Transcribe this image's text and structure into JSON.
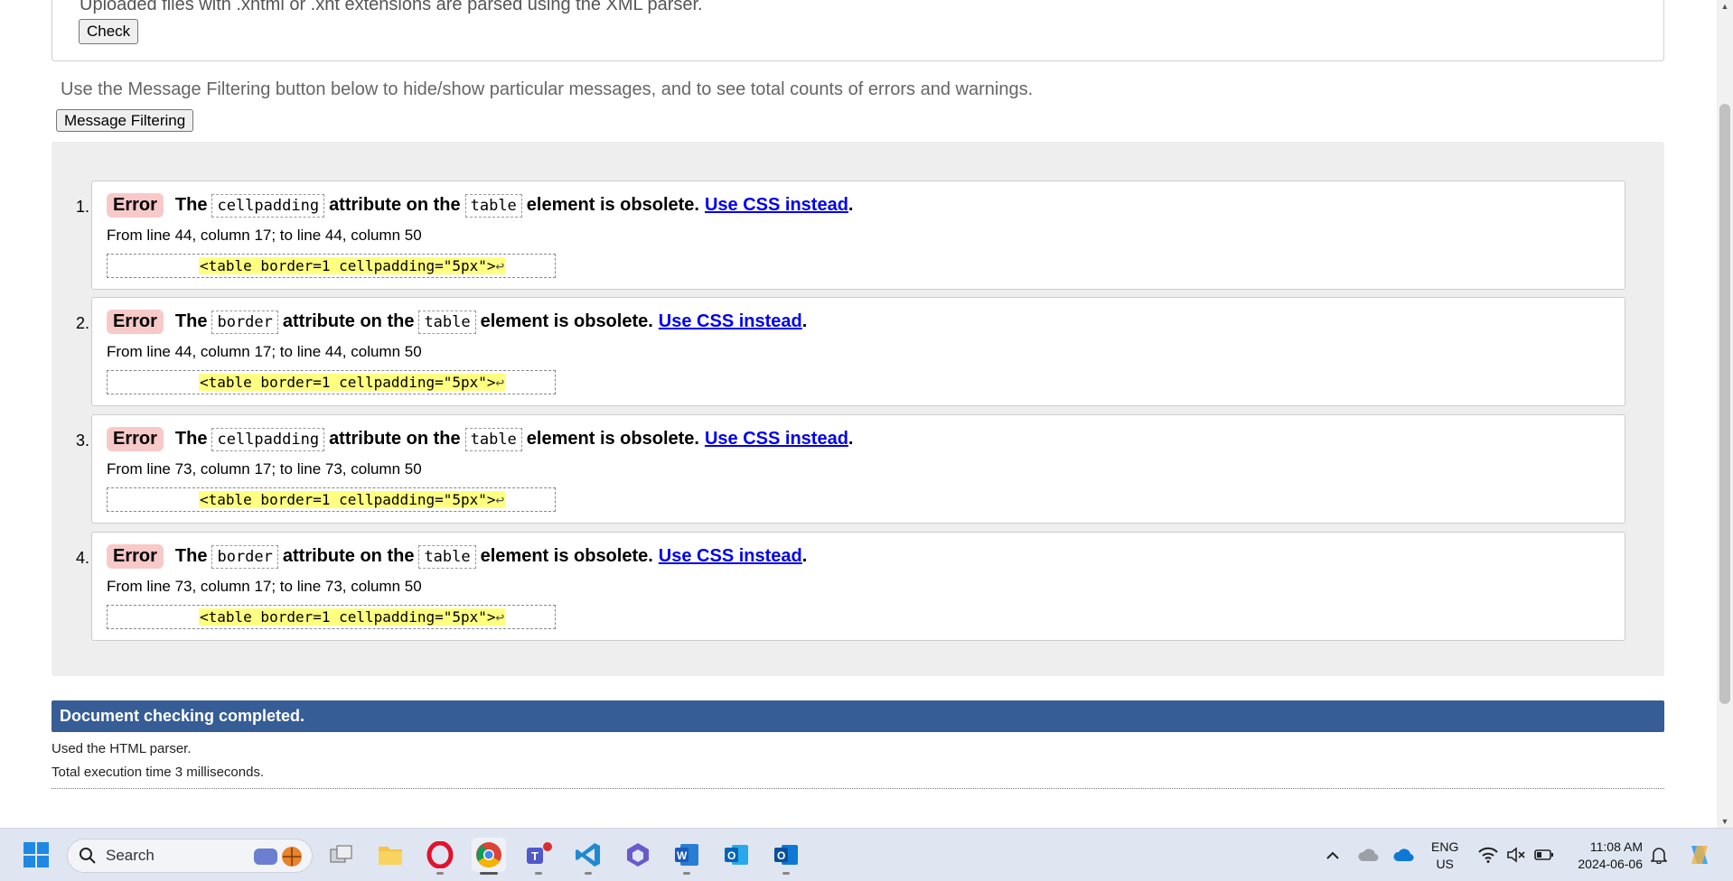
{
  "upload": {
    "note": "Uploaded files with .xhtml or .xht extensions are parsed using the XML parser.",
    "check_label": "Check"
  },
  "filter": {
    "note": "Use the Message Filtering button below to hide/show particular messages, and to see total counts of errors and warnings.",
    "button_label": "Message Filtering"
  },
  "messages": [
    {
      "num": "1.",
      "type": "Error",
      "the": "The",
      "attr": "cellpadding",
      "mid": "attribute on the",
      "el": "table",
      "tail": "element is obsolete.",
      "link": "Use CSS instead",
      "loc": "From line 44, column 17; to line 44, column 50",
      "extract": "<table border=1 cellpadding=\"5px\">"
    },
    {
      "num": "2.",
      "type": "Error",
      "the": "The",
      "attr": "border",
      "mid": "attribute on the",
      "el": "table",
      "tail": "element is obsolete.",
      "link": "Use CSS instead",
      "loc": "From line 44, column 17; to line 44, column 50",
      "extract": "<table border=1 cellpadding=\"5px\">"
    },
    {
      "num": "3.",
      "type": "Error",
      "the": "The",
      "attr": "cellpadding",
      "mid": "attribute on the",
      "el": "table",
      "tail": "element is obsolete.",
      "link": "Use CSS instead",
      "loc": "From line 73, column 17; to line 73, column 50",
      "extract": "<table border=1 cellpadding=\"5px\">"
    },
    {
      "num": "4.",
      "type": "Error",
      "the": "The",
      "attr": "border",
      "mid": "attribute on the",
      "el": "table",
      "tail": "element is obsolete.",
      "link": "Use CSS instead",
      "loc": "From line 73, column 17; to line 73, column 50",
      "extract": "<table border=1 cellpadding=\"5px\">"
    }
  ],
  "summary": {
    "done": "Document checking completed.",
    "parser": "Used the HTML parser.",
    "time": "Total execution time 3 milliseconds."
  },
  "taskbar": {
    "search_label": "Search",
    "lang_top": "ENG",
    "lang_bottom": "US",
    "time": "11:08 AM",
    "date": "2024-06-06",
    "apps": [
      "start-icon",
      "task-view-icon",
      "file-explorer-icon",
      "opera-icon",
      "chrome-icon",
      "teams-icon",
      "vscode-icon",
      "copilot-icon",
      "word-icon",
      "outlook-icon",
      "outlook-new-icon"
    ],
    "accent": "#365d95"
  }
}
